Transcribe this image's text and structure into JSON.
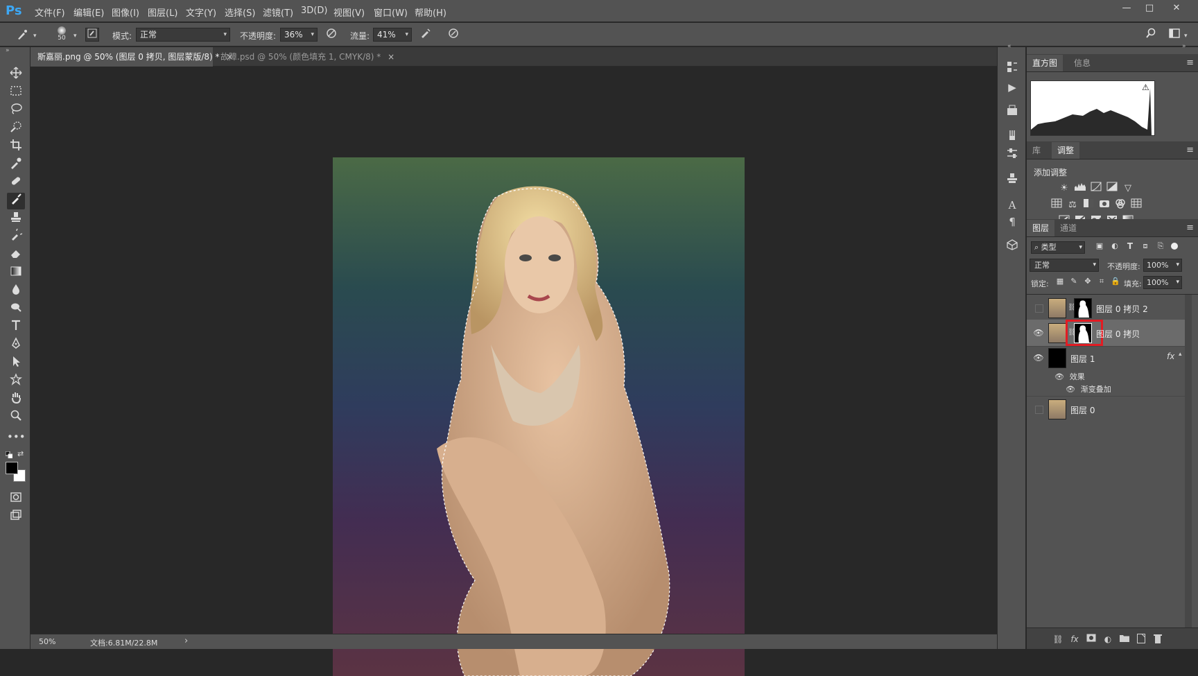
{
  "app": {
    "logo": "Ps"
  },
  "menu": [
    "文件(F)",
    "编辑(E)",
    "图像(I)",
    "图层(L)",
    "文字(Y)",
    "选择(S)",
    "滤镜(T)",
    "3D(D)",
    "视图(V)",
    "窗口(W)",
    "帮助(H)"
  ],
  "window_buttons": {
    "minimize": "—",
    "maximize": "□",
    "close": "✕"
  },
  "options": {
    "brush_size": "50",
    "mode_label": "模式:",
    "mode_value": "正常",
    "opacity_label": "不透明度:",
    "opacity_value": "36%",
    "flow_label": "流量:",
    "flow_value": "41%"
  },
  "tabs": [
    {
      "label": "斯嘉丽.png @ 50% (图层 0 拷贝, 图层蒙版/8) *",
      "close": "×"
    },
    {
      "label": "故障.psd @ 50% (颜色填充 1, CMYK/8) *",
      "close": "×"
    }
  ],
  "status": {
    "zoom": "50%",
    "doc": "文档:6.81M/22.8M",
    "arrow": "›"
  },
  "histogram_panel": {
    "tabs": [
      "直方图",
      "信息"
    ]
  },
  "adjust_panel": {
    "tabs": [
      "库",
      "调整"
    ],
    "title": "添加调整"
  },
  "layers_panel": {
    "tabs": [
      "图层",
      "通道"
    ],
    "filter_label": "类型",
    "blend_mode": "正常",
    "opacity_label": "不透明度:",
    "opacity_value": "100%",
    "lock_label": "锁定:",
    "fill_label": "填充:",
    "fill_value": "100%",
    "layers": [
      {
        "name": "图层 0 拷贝 2",
        "visible": false
      },
      {
        "name": "图层 0 拷贝",
        "visible": true,
        "selected": true
      },
      {
        "name": "图层 1",
        "visible": true
      },
      {
        "name": "图层 0",
        "visible": false
      }
    ],
    "effects_label": "效果",
    "effect_name": "渐变叠加",
    "fx_label": "fx"
  },
  "colors": {
    "ui_bg": "#535353",
    "workspace": "#282828",
    "highlight_red": "#e21c23",
    "ps_blue": "#3da8f5"
  }
}
